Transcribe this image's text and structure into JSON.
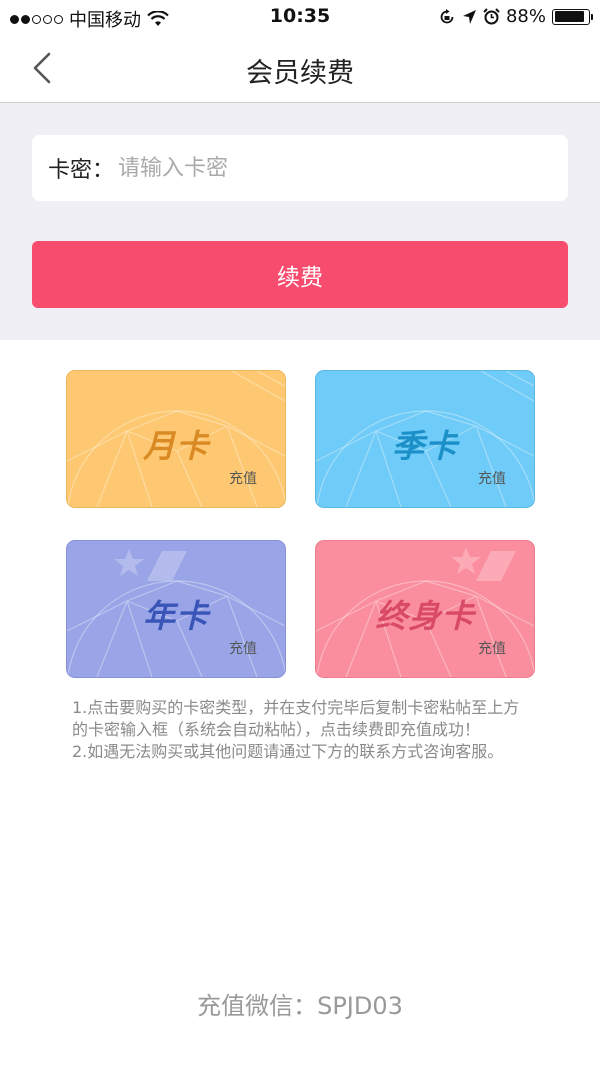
{
  "status_bar": {
    "carrier": "中国移动",
    "time": "10:35",
    "battery_text": "88%",
    "battery_level": 0.88,
    "signal_bars": 2
  },
  "nav": {
    "title": "会员续费",
    "back_icon": "chevron-left-icon"
  },
  "form": {
    "label": "卡密：",
    "placeholder": "请输入卡密",
    "value": "",
    "button_label": "续费"
  },
  "cards": [
    {
      "title": "月卡",
      "action": "充值",
      "color": "#fdc871"
    },
    {
      "title": "季卡",
      "action": "充值",
      "color": "#6fcbf7"
    },
    {
      "title": "年卡",
      "action": "充值",
      "color": "#99a5e6"
    },
    {
      "title": "终身卡",
      "action": "充值",
      "color": "#fa8e9e"
    }
  ],
  "instructions": [
    "1.点击要购买的卡密类型，并在支付完毕后复制卡密粘帖至上方的卡密输入框（系统会自动粘帖），点击续费即充值成功！",
    "2.如遇无法购买或其他问题请通过下方的联系方式咨询客服。"
  ],
  "contact": {
    "text": "充值微信：SPJD03"
  },
  "colors": {
    "accent": "#f84c6e",
    "section_bg": "#efeff5"
  }
}
